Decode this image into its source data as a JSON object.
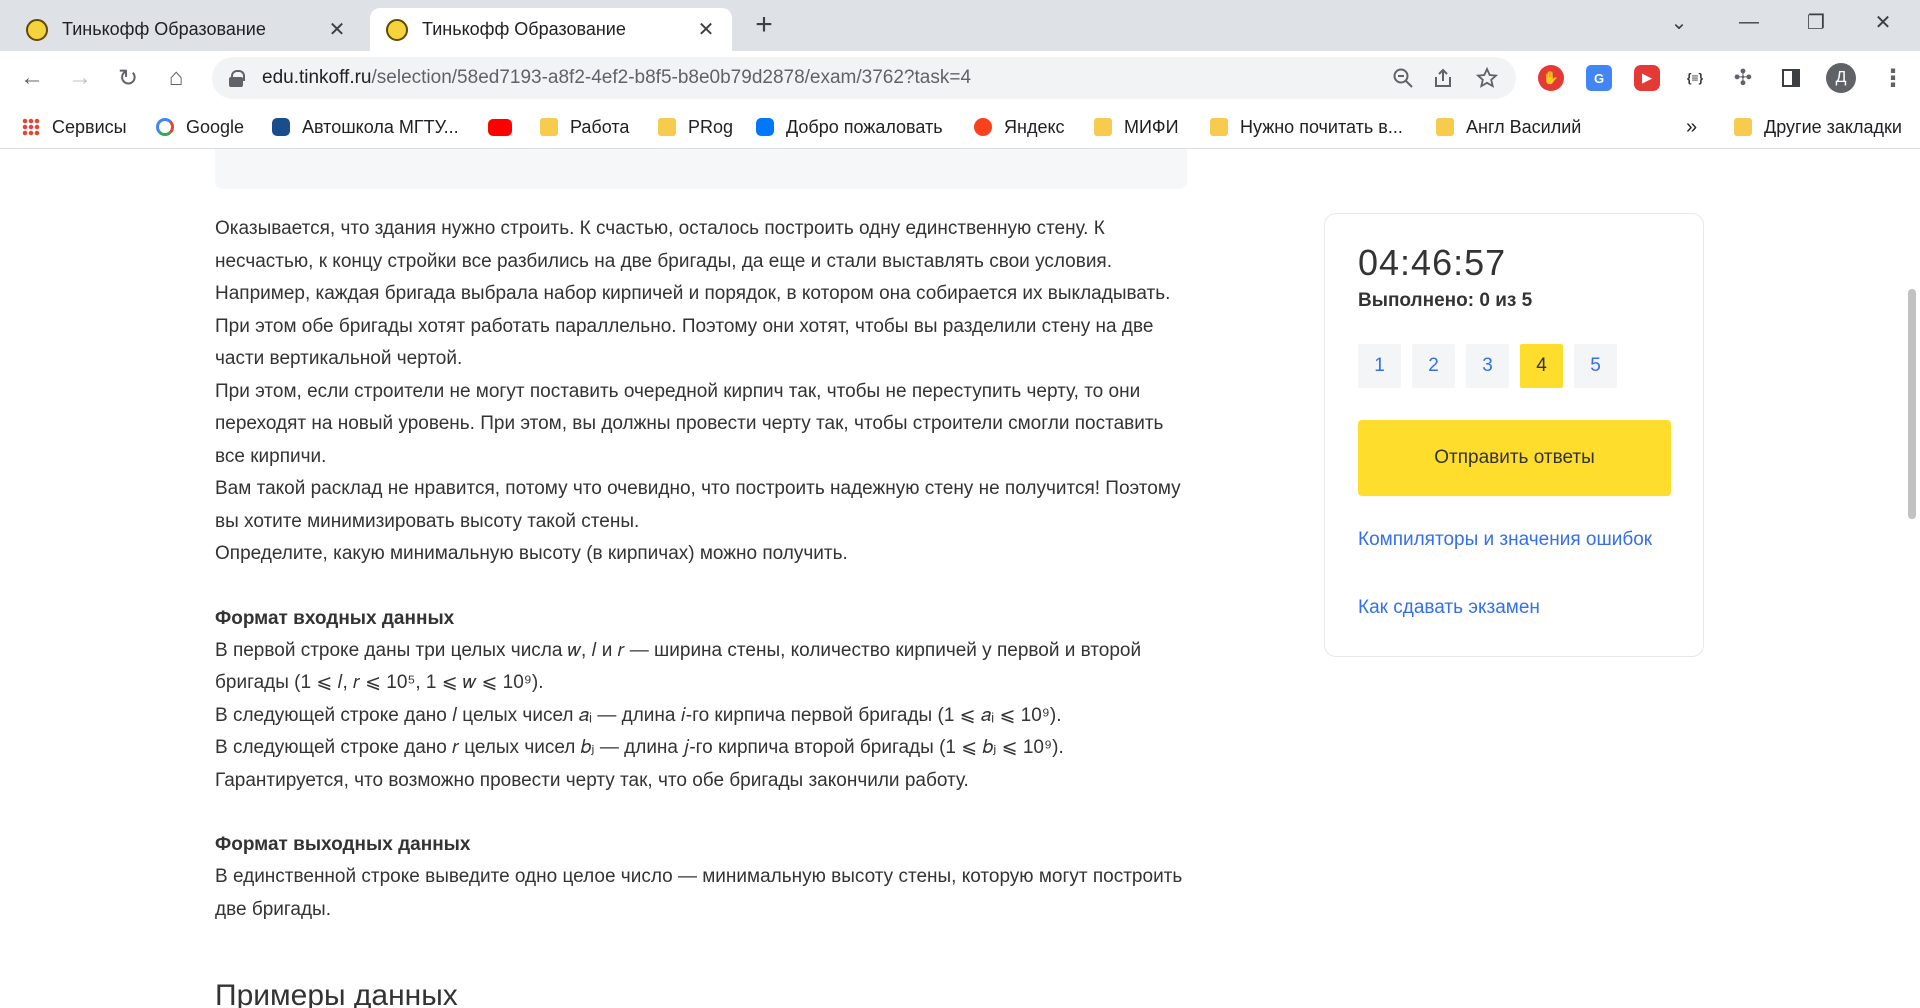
{
  "tabs": [
    {
      "title": "Тинькофф Образование",
      "close": "✕"
    },
    {
      "title": "Тинькофф Образование",
      "close": "✕"
    }
  ],
  "new_tab": "+",
  "window_controls": {
    "minimize": "—",
    "restore": "❐",
    "close": "✕",
    "dropdown": "⌄"
  },
  "nav": {
    "back": "←",
    "forward": "→",
    "reload": "↻",
    "home": "⌂"
  },
  "address": {
    "domain": "edu.tinkoff.ru",
    "path": "/selection/58ed7193-a8f2-4ef2-b8f5-b8e0b79d2878/exam/3762?task=4"
  },
  "omnibox_icons": [
    "zoom-icon",
    "share-icon",
    "star-icon"
  ],
  "extensions": [
    "adblock-icon",
    "translate-icon",
    "youtube-ext-icon",
    "json-ext-icon",
    "puzzle-icon",
    "sidepanel-icon"
  ],
  "profile_letter": "Д",
  "menu": "⋮",
  "bookmarks": [
    {
      "label": "Сервисы",
      "icon": "apps-icon"
    },
    {
      "label": "Google",
      "icon": "google-icon"
    },
    {
      "label": "Автошкола МГТУ...",
      "icon": "car-icon"
    },
    {
      "label": "",
      "icon": "youtube-icon"
    },
    {
      "label": "Работа",
      "icon": "folder-icon"
    },
    {
      "label": "PRog",
      "icon": "folder-icon"
    },
    {
      "label": "Добро пожаловать",
      "icon": "vk-icon"
    },
    {
      "label": "Яндекс",
      "icon": "yandex-icon"
    },
    {
      "label": "МИФИ",
      "icon": "folder-icon"
    },
    {
      "label": "Нужно почитать в...",
      "icon": "folder-icon"
    },
    {
      "label": "Англ Василий",
      "icon": "folder-icon"
    }
  ],
  "bookmarks_more": "»",
  "other_bookmarks": "Другие закладки",
  "problem": {
    "paragraphs": [
      "Оказывается, что здания нужно строить. К счастью, осталось построить одну единственную стену. К несчастью, к концу стройки все разбились на две бригады, да еще и стали выставлять свои условия. Например, каждая бригада выбрала набор кирпичей и порядок, в котором она собирается их выкладывать. При этом обе бригады хотят работать параллельно. Поэтому они хотят, чтобы вы разделили стену на две части вертикальной чертой.",
      "При этом, если строители не могут поставить очередной кирпич так, чтобы не переступить черту, то они переходят на новый уровень. При этом, вы должны провести черту так, чтобы строители смогли поставить все кирпичи.",
      "Вам такой расклад не нравится, потому что очевидно, что построить надежную стену не получится! Поэтому вы хотите минимизировать высоту такой стены.",
      "Определите, какую минимальную высоту (в кирпичах) можно получить."
    ],
    "input_title": "Формат входных данных",
    "input_lines": [
      "В первой строке даны три целых числа 𝑤, 𝑙 и 𝑟 — ширина стены, количество кирпичей у первой и второй бригады (1 ⩽ 𝑙, 𝑟 ⩽ 10⁵, 1 ⩽ 𝑤 ⩽ 10⁹).",
      "В следующей строке дано 𝑙 целых чисел 𝑎ᵢ — длина 𝑖-го кирпича первой бригады (1 ⩽ 𝑎ᵢ ⩽ 10⁹).",
      "В следующей строке дано 𝑟 целых чисел 𝑏ⱼ — длина 𝑗-го кирпича второй бригады (1 ⩽ 𝑏ⱼ ⩽ 10⁹).",
      "Гарантируется, что возможно провести черту так, что обе бригады закончили работу."
    ],
    "output_title": "Формат выходных данных",
    "output_text": "В единственной строке выведите одно целое число — минимальную высоту стены, которую могут построить две бригады.",
    "examples_title": "Примеры данных"
  },
  "sidebar": {
    "timer": "04:46:57",
    "progress": "Выполнено: 0 из 5",
    "tasks": [
      "1",
      "2",
      "3",
      "4",
      "5"
    ],
    "active_task": "4",
    "submit_label": "Отправить ответы",
    "link_compilers": "Компиляторы и значения ошибок",
    "link_howto": "Как сдавать экзамен"
  },
  "colors": {
    "accent_yellow": "#ffdd2d",
    "link_blue": "#336fee",
    "text": "#333333"
  }
}
